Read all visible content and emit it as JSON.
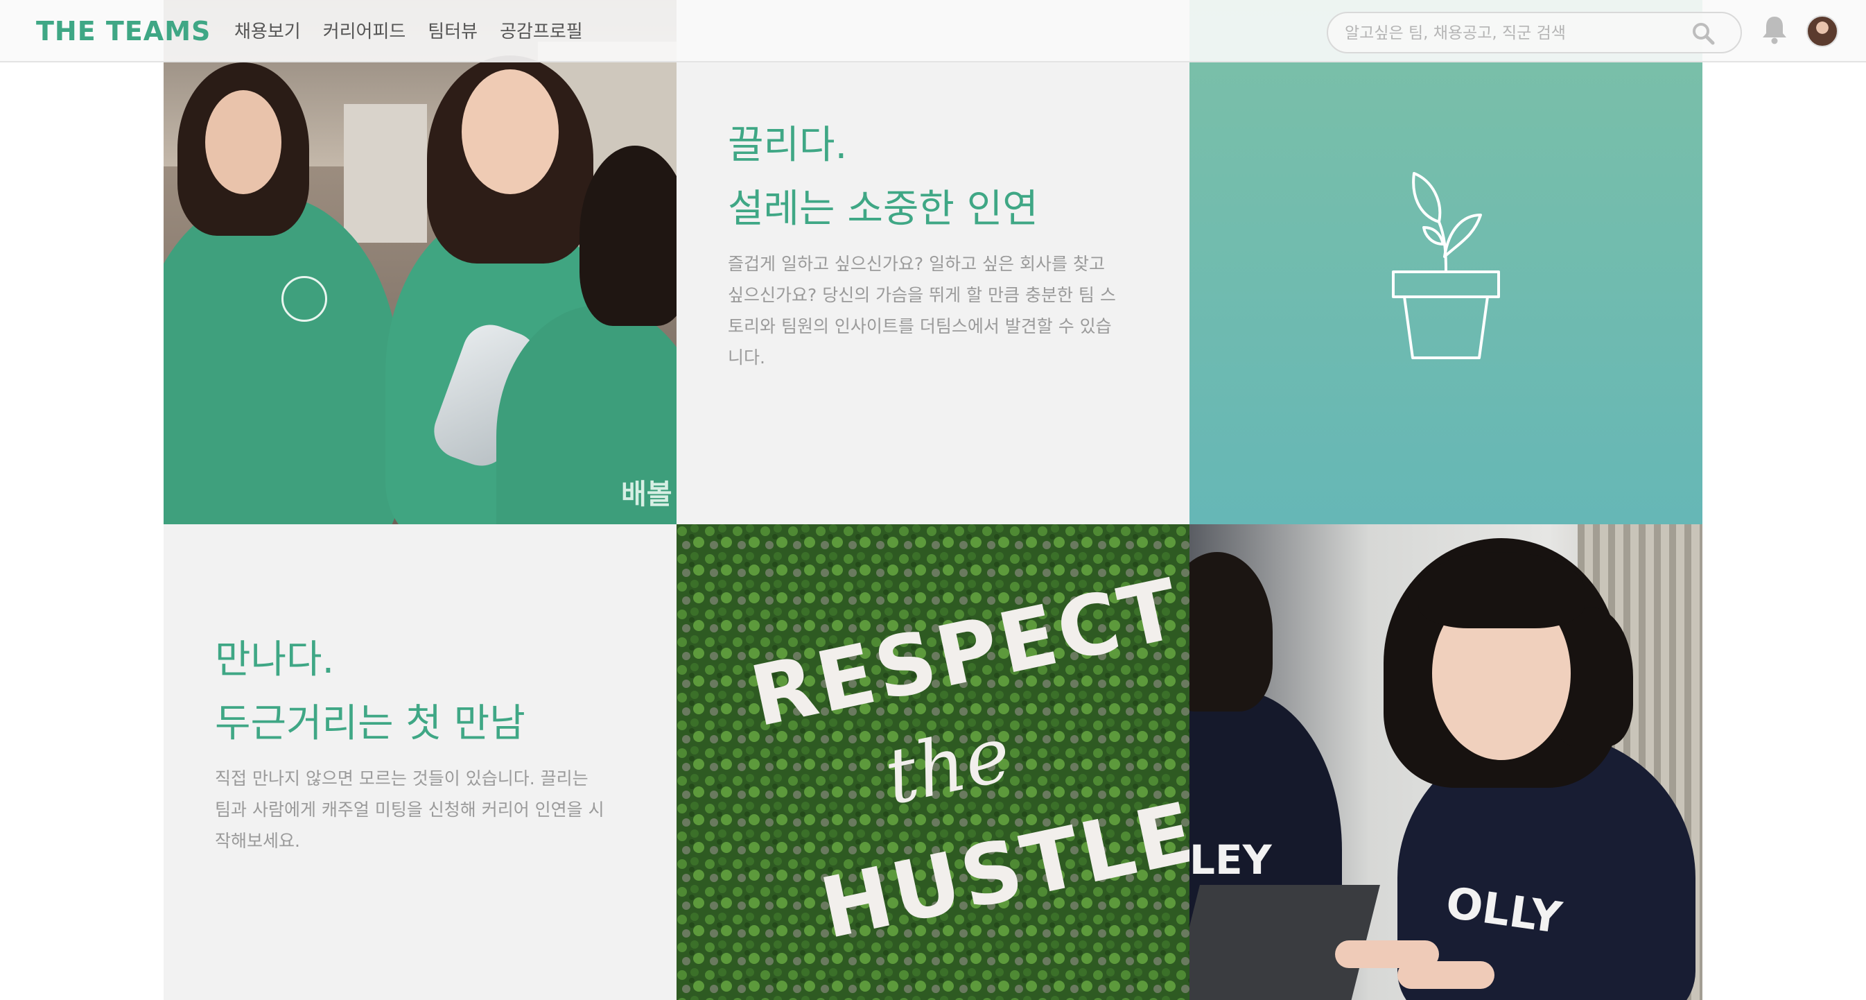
{
  "header": {
    "logo": "THE TEAMS",
    "nav": [
      "채용보기",
      "커리어피드",
      "팀터뷰",
      "공감프로필"
    ],
    "search_placeholder": "알고싶은 팀, 채용공고, 직군 검색"
  },
  "cards": {
    "card1": {
      "heading_line1": "끌리다.",
      "heading_line2": "설레는 소중한 인연",
      "body_lines": [
        "즐겁게 일하고 싶으신가요? 일하고 싶은 회사를 찾고",
        "싶으신가요? 당신의 가슴을 뛰게 할 만큼 충분한 팀 스",
        "토리와 팀원의 인사이트를 더팀스에서 발견할 수 있습",
        "니다."
      ]
    },
    "card2": {
      "heading_line1": "만나다.",
      "heading_line2": "두근거리는 첫 만남",
      "body_lines": [
        "직접 만나지 않으면 모르는 것들이 있습니다. 끌리는",
        "팀과 사람에게 캐주얼 미팅을 신청해 커리어 인연을 시",
        "작해보세요."
      ]
    }
  },
  "photo_text": {
    "sweatshirt": "배볼",
    "sign_line1": "RESPECT",
    "sign_line2": "the",
    "sign_line3": "HUSTLE",
    "tshirt_left": "LEY",
    "tshirt_right": "OLLY"
  },
  "colors": {
    "brand_green": "#3fa785",
    "teal_tile": "#6dbbae",
    "body_text": "#9a9a9a"
  },
  "icons": [
    "search-icon",
    "bell-icon",
    "plant-icon"
  ]
}
